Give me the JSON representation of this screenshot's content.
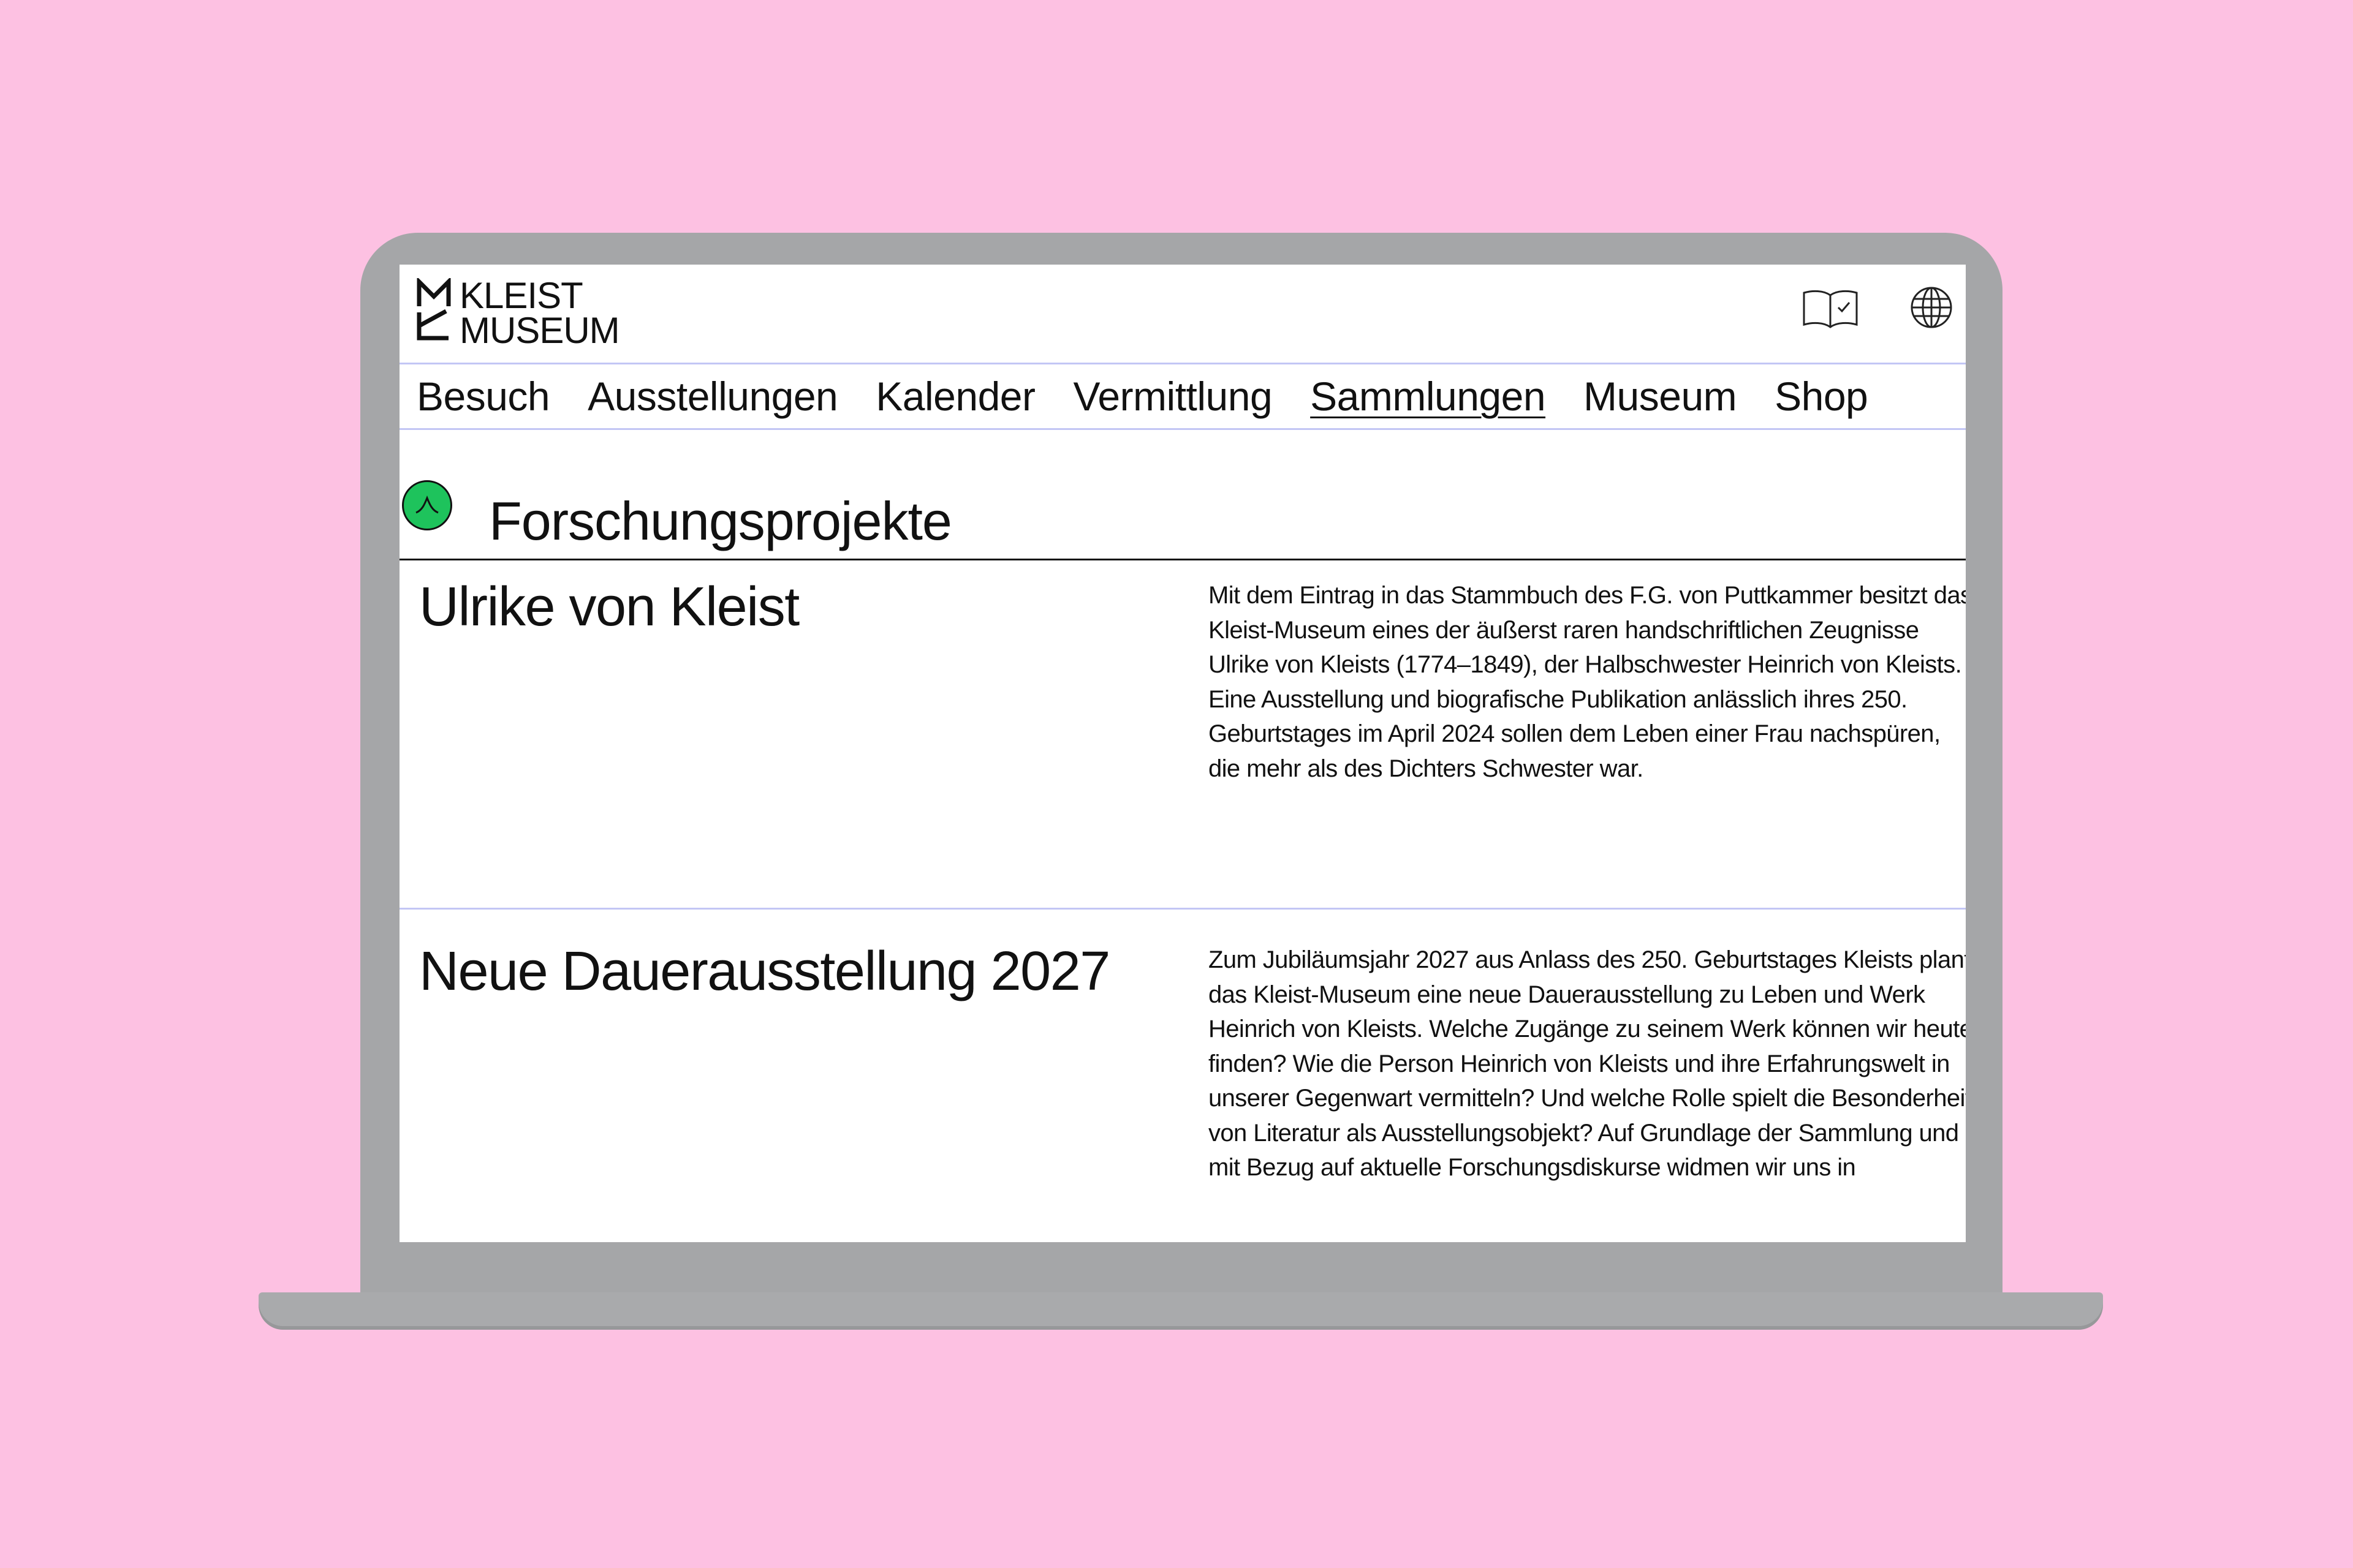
{
  "header": {
    "logo_line1": "KLEIST",
    "logo_line2": "MUSEUM",
    "icons": [
      "book-check-icon",
      "globe-icon"
    ]
  },
  "nav": {
    "items": [
      {
        "label": "Besuch"
      },
      {
        "label": "Ausstellungen"
      },
      {
        "label": "Kalender"
      },
      {
        "label": "Vermittlung"
      },
      {
        "label": "Sammlungen",
        "active": true
      },
      {
        "label": "Museum"
      },
      {
        "label": "Shop"
      }
    ]
  },
  "section": {
    "title": "Forschungsprojekte",
    "badge_icon": "arch-icon",
    "badge_color": "#1ec35c"
  },
  "projects": [
    {
      "title": "Ulrike von Kleist",
      "text": "Mit dem Eintrag in das Stammbuch des F.G. von Puttkammer besitzt das Kleist-Museum eines der äußerst raren handschriftlichen Zeugnisse Ulrike von Kleists (1774–1849), der Halbschwester Heinrich von Kleists. Eine Ausstellung und biografische Publikation anlässlich ihres 250. Geburtstages im April 2024 sollen dem Leben einer Frau nachspüren, die mehr als des Dichters Schwester war."
    },
    {
      "title": "Neue Dauerausstellung 2027",
      "text": "Zum Jubiläumsjahr 2027 aus Anlass des 250. Geburtstages Kleists plant das Kleist-Museum eine neue Dauerausstellung zu Leben und Werk Heinrich von Kleists. Welche Zugänge zu seinem Werk können wir heute finden? Wie die Person Heinrich von Kleists und ihre Erfahrungswelt in unserer Gegenwart vermitteln? Und welche Rolle spielt die Besonderheit von Literatur als Ausstellungsobjekt? Auf Grundlage der Sammlung und mit Bezug auf aktuelle Forschungsdiskurse widmen wir uns in"
    }
  ],
  "colors": {
    "background": "#fdc1e2",
    "laptop": "#a5a6a8",
    "divider": "#c3c6f5"
  }
}
